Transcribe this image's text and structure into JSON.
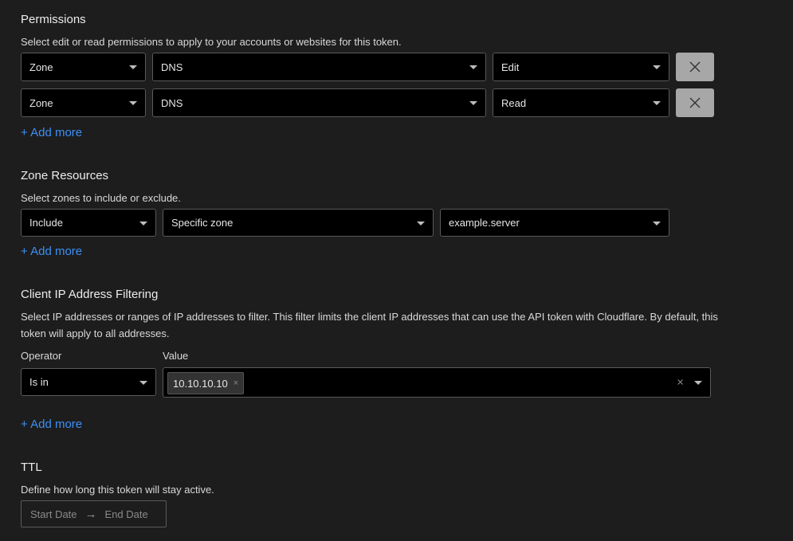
{
  "permissions": {
    "title": "Permissions",
    "description": "Select edit or read permissions to apply to your accounts or websites for this token.",
    "rows": [
      {
        "scope": "Zone",
        "resource": "DNS",
        "level": "Edit"
      },
      {
        "scope": "Zone",
        "resource": "DNS",
        "level": "Read"
      }
    ],
    "add_more": "+ Add more"
  },
  "zone_resources": {
    "title": "Zone Resources",
    "description": "Select zones to include or exclude.",
    "include": "Include",
    "target": "Specific zone",
    "zone": "example.server",
    "add_more": "+ Add more"
  },
  "client_ip": {
    "title": "Client IP Address Filtering",
    "description": "Select IP addresses or ranges of IP addresses to filter. This filter limits the client IP addresses that can use the API token with Cloudflare. By default, this token will apply to all addresses.",
    "operator_label": "Operator",
    "value_label": "Value",
    "operator": "Is in",
    "values": [
      "10.10.10.10"
    ],
    "tag_remove_glyph": "×",
    "clear_glyph": "×",
    "add_more": "+ Add more"
  },
  "ttl": {
    "title": "TTL",
    "description": "Define how long this token will stay active.",
    "start_placeholder": "Start Date",
    "arrow_glyph": "→",
    "end_placeholder": "End Date"
  },
  "icons": {
    "remove": "close-icon",
    "dropdown": "chevron-down-icon",
    "range": "arrow-right-icon"
  },
  "colors": {
    "background": "#1d1d1d",
    "field": "#000000",
    "link": "#3d8ff5",
    "remove_button": "#a7a7a7"
  }
}
